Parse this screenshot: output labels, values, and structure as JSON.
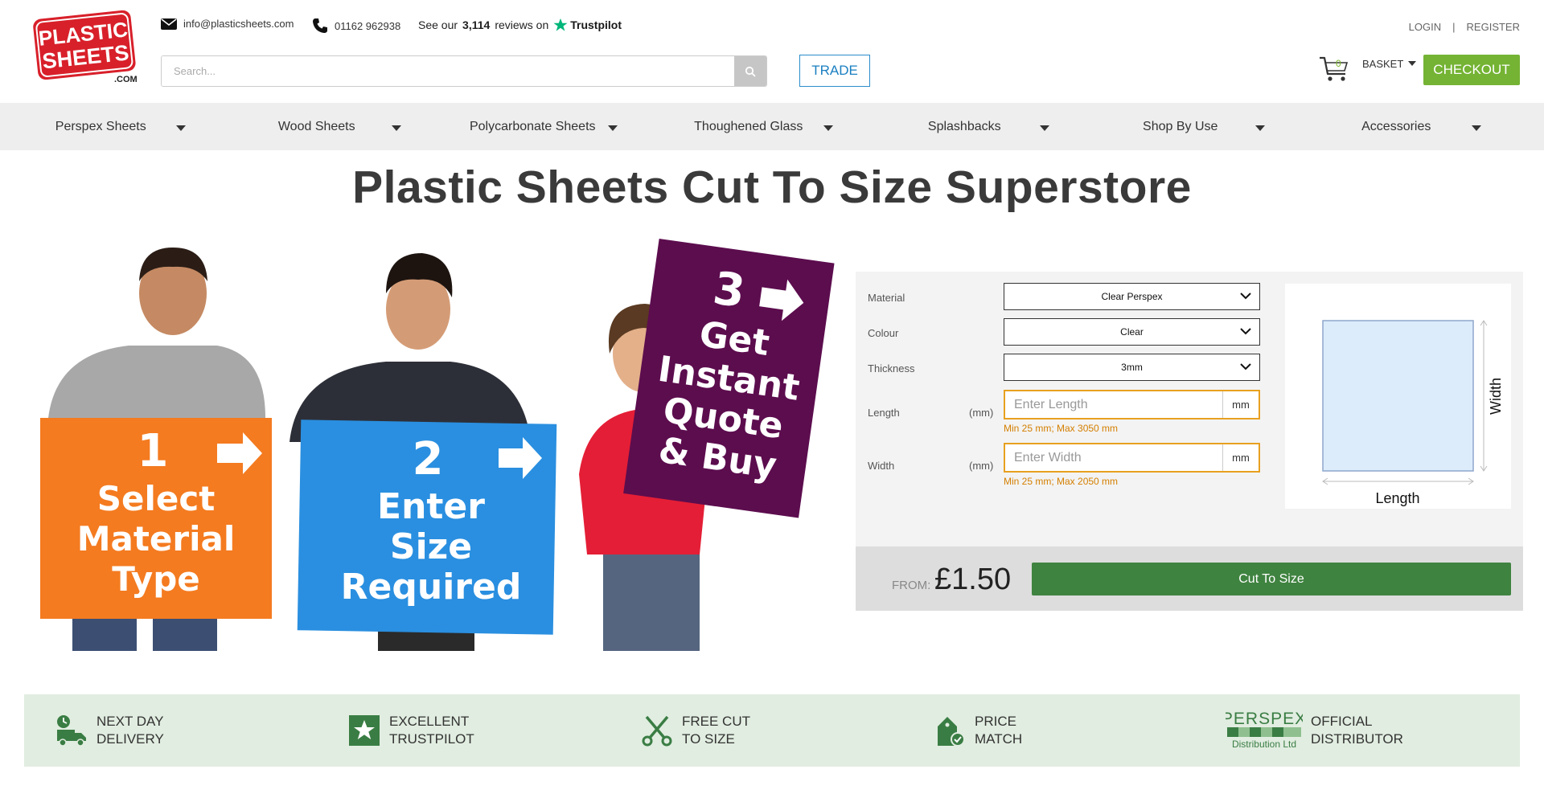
{
  "header": {
    "logo_text_line1": "PLASTIC",
    "logo_text_line2": "SHEETS",
    "logo_text_line3": ".COM",
    "email": "info@plasticsheets.com",
    "phone": "01162 962938",
    "reviews_prefix": "See our",
    "reviews_count": "3,114",
    "reviews_suffix": "reviews on",
    "trustpilot": "Trustpilot",
    "search_placeholder": "Search...",
    "trade_label": "TRADE",
    "login": "LOGIN",
    "separator": "|",
    "register": "REGISTER",
    "cart_count": "0",
    "basket_label": "BASKET",
    "checkout_label": "CHECKOUT"
  },
  "nav": [
    {
      "label": "Perspex Sheets"
    },
    {
      "label": "Wood Sheets"
    },
    {
      "label": "Polycarbonate Sheets"
    },
    {
      "label": "Thoughened Glass"
    },
    {
      "label": "Splashbacks"
    },
    {
      "label": "Shop By Use"
    },
    {
      "label": "Accessories"
    }
  ],
  "page_title": "Plastic Sheets Cut To Size Superstore",
  "hero": {
    "sign1": {
      "num": "1",
      "line1": "Select",
      "line2": "Material",
      "line3": "Type",
      "color": "#f47b20"
    },
    "sign2": {
      "num": "2",
      "line1": "Enter",
      "line2": "Size",
      "line3": "Required",
      "color": "#2a8fe0"
    },
    "sign3": {
      "num": "3",
      "line1": "Get",
      "line2": "Instant",
      "line3": "Quote",
      "line4": "& Buy",
      "color": "#5c0d4e"
    }
  },
  "config": {
    "material_label": "Material",
    "material_value": "Clear Perspex",
    "colour_label": "Colour",
    "colour_value": "Clear",
    "thickness_label": "Thickness",
    "thickness_value": "3mm",
    "length_label": "Length",
    "length_unit_label": "(mm)",
    "length_placeholder": "Enter Length",
    "length_unit": "mm",
    "length_hint": "Min 25 mm; Max 3050 mm",
    "width_label": "Width",
    "width_unit_label": "(mm)",
    "width_placeholder": "Enter Width",
    "width_unit": "mm",
    "width_hint": "Min 25 mm; Max 2050 mm",
    "preview_width_label": "Width",
    "preview_length_label": "Length",
    "from_label": "FROM:",
    "price": "£1.50",
    "cut_button": "Cut To Size"
  },
  "features": [
    {
      "line1": "NEXT DAY",
      "line2": "DELIVERY",
      "icon": "delivery-truck-icon"
    },
    {
      "line1": "EXCELLENT",
      "line2": "TRUSTPILOT",
      "icon": "trustpilot-star-icon"
    },
    {
      "line1": "FREE CUT",
      "line2": "TO SIZE",
      "icon": "scissors-icon"
    },
    {
      "line1": "PRICE",
      "line2": "MATCH",
      "icon": "price-tag-icon"
    },
    {
      "line1": "OFFICIAL",
      "line2": "DISTRIBUTOR",
      "icon": "perspex-logo"
    }
  ],
  "perspex_logo": {
    "line1": "PERSPEX",
    "line2": "Distribution Ltd"
  },
  "colors": {
    "accent_green": "#74b333",
    "button_green": "#3f8340",
    "trade_blue": "#1a7fc1",
    "warning_orange": "#e8a020",
    "feature_bg": "#e1ede0",
    "logo_red": "#d8202a"
  }
}
